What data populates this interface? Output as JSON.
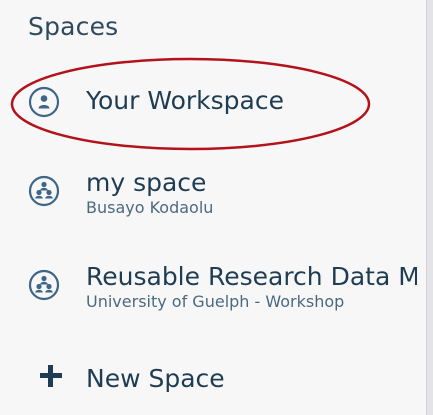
{
  "sidebar": {
    "heading": "Spaces",
    "items": [
      {
        "title": "Your Workspace",
        "subtitle": "",
        "icon": "person-icon",
        "highlighted": true
      },
      {
        "title": "my space",
        "subtitle": "Busayo Kodaolu",
        "icon": "group-icon",
        "highlighted": false
      },
      {
        "title": "Reusable Research Data M",
        "subtitle": "University of Guelph - Workshop",
        "icon": "group-icon",
        "highlighted": false
      }
    ],
    "new_space_label": "New Space"
  },
  "colors": {
    "text": "#1f3d52",
    "subtext": "#4b6a80",
    "highlight_ring": "#b3121a",
    "background": "#f7f7f8"
  }
}
